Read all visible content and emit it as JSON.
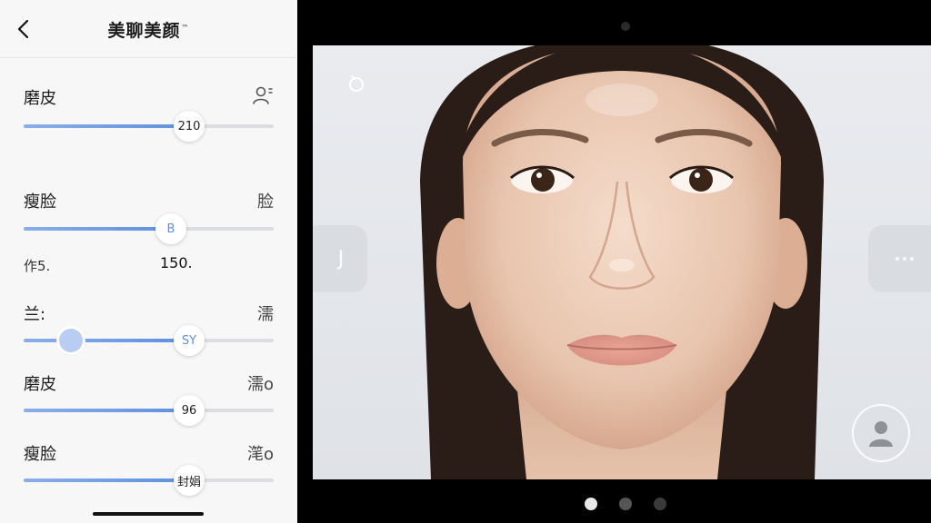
{
  "header": {
    "title": "美聊美颜",
    "title_mark": "™"
  },
  "sliders": [
    {
      "label": "磨皮",
      "value_label": "210",
      "fraction": 0.66,
      "right_icon": "person-icon"
    },
    {
      "label": "瘦脸",
      "value_label": "B",
      "fraction": 0.59,
      "right_text": "脸"
    },
    {
      "label": "兰:",
      "value_label": "SY",
      "fraction": 0.66,
      "secondary_fraction": 0.19,
      "right_text": "濡"
    },
    {
      "label": "磨皮",
      "value_label": "96",
      "fraction": 0.66,
      "right_text": "濡o"
    },
    {
      "label": "瘦脸",
      "value_label": "封娟",
      "fraction": 0.66,
      "right_text": "滗o"
    }
  ],
  "row2_sub": {
    "left": "作5.",
    "center": "150."
  },
  "viewer": {
    "left_button_label": "J",
    "icons": [
      "timer-icon",
      "more-icon",
      "avatar-icon"
    ]
  },
  "pagination": {
    "count": 3,
    "active_index": 0
  },
  "colors": {
    "accent": "#5f8fe0",
    "panel_bg": "#f7f7f8",
    "photo_bg": "#e9ebef"
  }
}
